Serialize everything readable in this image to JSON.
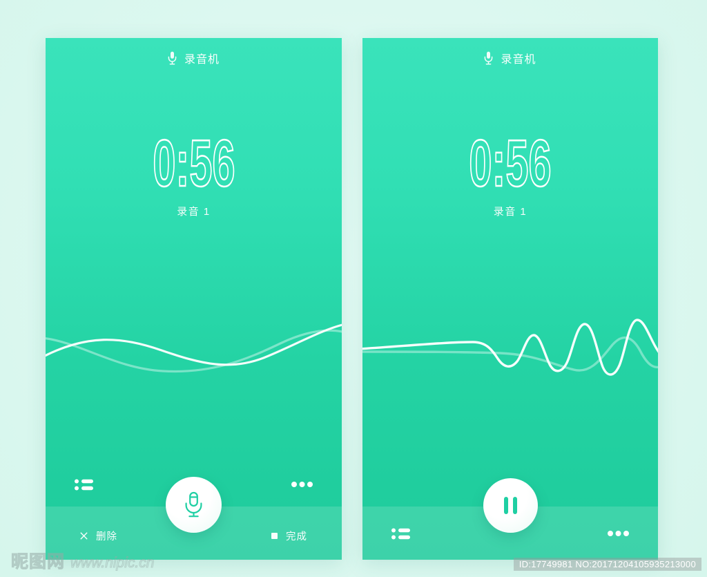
{
  "page": {
    "background_color": "#dcf8f0",
    "accent_color": "#2ddbb0",
    "screen_gradient_top": "#3ae3bb",
    "screen_gradient_bottom": "#1ecb9b",
    "fab_color": "#ffffff",
    "icon_green": "#1fcfa3"
  },
  "screens": [
    {
      "id": "recording",
      "header": {
        "icon": "microphone-icon",
        "title": "录音机"
      },
      "timer": {
        "value": "0:56",
        "clip_label": "录音 1"
      },
      "waveform": {
        "style": "smooth-dual-sine",
        "lines": [
          {
            "name": "primary-wave",
            "color": "#ffffff",
            "opacity": 0.95
          },
          {
            "name": "secondary-wave",
            "color": "#ffffff",
            "opacity": 0.42
          }
        ]
      },
      "controls": {
        "list_icon": "list-icon",
        "more_icon": "more-options-icon",
        "fab": {
          "icon": "microphone-icon",
          "state": "record"
        }
      },
      "actions": [
        {
          "icon": "close-icon",
          "label": "删除"
        },
        {
          "icon": "stop-square-icon",
          "label": "完成"
        }
      ]
    },
    {
      "id": "recording-active",
      "header": {
        "icon": "microphone-icon",
        "title": "录音机"
      },
      "timer": {
        "value": "0:56",
        "clip_label": "录音 1"
      },
      "waveform": {
        "style": "rising-amplitude",
        "lines": [
          {
            "name": "primary-wave",
            "color": "#ffffff",
            "opacity": 0.95
          },
          {
            "name": "secondary-wave",
            "color": "#ffffff",
            "opacity": 0.42
          }
        ]
      },
      "controls": {
        "list_icon": "list-icon",
        "more_icon": "more-options-icon",
        "fab": {
          "icon": "pause-icon",
          "state": "pause"
        }
      },
      "actions": []
    }
  ],
  "watermark": {
    "brand_cn": "昵图网",
    "brand_url": "www.nipic.cn",
    "id_text": "ID:17749981 NO:20171204105935213000"
  }
}
